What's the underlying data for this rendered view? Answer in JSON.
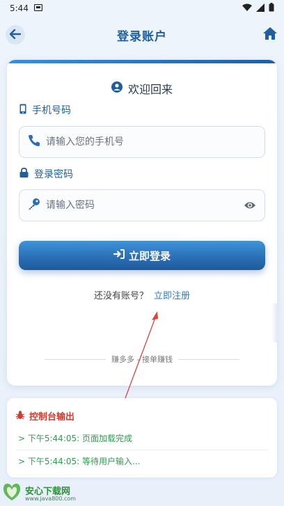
{
  "status_bar": {
    "time": "5:44"
  },
  "header": {
    "title": "登录账户"
  },
  "card": {
    "welcome": "欢迎回来",
    "phone_label": "手机号码",
    "phone_placeholder": "请输入您的手机号",
    "password_label": "登录密码",
    "password_placeholder": "请输入密码",
    "login_button": "立即登录",
    "no_account_text": "还没有账号？",
    "register_link": "立即注册",
    "slogan": "赚多多 - 接单赚钱"
  },
  "console": {
    "title": "控制台输出",
    "lines": [
      "> 下午5:44:05: 页面加载完成",
      "> 下午5:44:05: 等待用户输入..."
    ]
  },
  "watermark": {
    "main": "安心下载网",
    "sub": "www.java800.com"
  },
  "colors": {
    "brand": "#1f5f9f",
    "accent": "#2a7cc7",
    "console_title": "#d33b2f",
    "console_text": "#2f9a52"
  }
}
